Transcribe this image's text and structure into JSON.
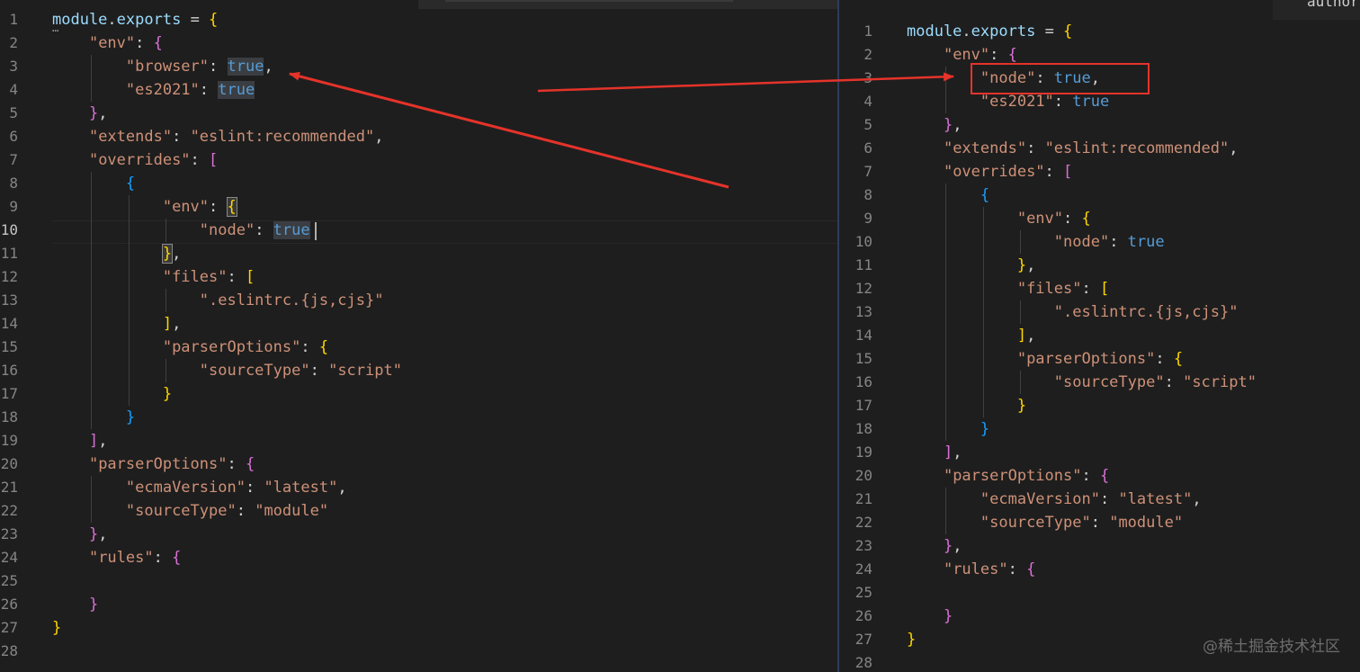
{
  "watermark": "@稀土掘金技术社区",
  "highlight_color": "#e5332a",
  "left_editor": {
    "active_line": 10,
    "line_numbers": [
      "1",
      "2",
      "3",
      "4",
      "5",
      "6",
      "7",
      "8",
      "9",
      "10",
      "11",
      "12",
      "13",
      "14",
      "15",
      "16",
      "17",
      "18",
      "19",
      "20",
      "21",
      "22",
      "23",
      "24",
      "25",
      "26",
      "27",
      "28"
    ],
    "lines": [
      "module.exports = {",
      "    \"env\": {",
      "        \"browser\": true,",
      "        \"es2021\": true",
      "    },",
      "    \"extends\": \"eslint:recommended\",",
      "    \"overrides\": [",
      "        {",
      "            \"env\": {",
      "                \"node\": true",
      "            },",
      "            \"files\": [",
      "                \".eslintrc.{js,cjs}\"",
      "            ],",
      "            \"parserOptions\": {",
      "                \"sourceType\": \"script\"",
      "            }",
      "        }",
      "    ],",
      "    \"parserOptions\": {",
      "        \"ecmaVersion\": \"latest\",",
      "        \"sourceType\": \"module\"",
      "    },",
      "    \"rules\": {",
      "",
      "    }",
      "}",
      ""
    ]
  },
  "right_editor": {
    "tab_fragment": "author",
    "line_numbers": [
      "1",
      "2",
      "3",
      "4",
      "5",
      "6",
      "7",
      "8",
      "9",
      "10",
      "11",
      "12",
      "13",
      "14",
      "15",
      "16",
      "17",
      "18",
      "19",
      "20",
      "21",
      "22",
      "23",
      "24",
      "25",
      "26",
      "27",
      "28"
    ],
    "lines": [
      "module.exports = {",
      "    \"env\": {",
      "        \"node\": true,",
      "        \"es2021\": true",
      "    },",
      "    \"extends\": \"eslint:recommended\",",
      "    \"overrides\": [",
      "        {",
      "            \"env\": {",
      "                \"node\": true",
      "            },",
      "            \"files\": [",
      "                \".eslintrc.{js,cjs}\"",
      "            ],",
      "            \"parserOptions\": {",
      "                \"sourceType\": \"script\"",
      "            }",
      "        }",
      "    ],",
      "    \"parserOptions\": {",
      "        \"ecmaVersion\": \"latest\",",
      "        \"sourceType\": \"module\"",
      "    },",
      "    \"rules\": {",
      "",
      "    }",
      "}",
      ""
    ]
  }
}
